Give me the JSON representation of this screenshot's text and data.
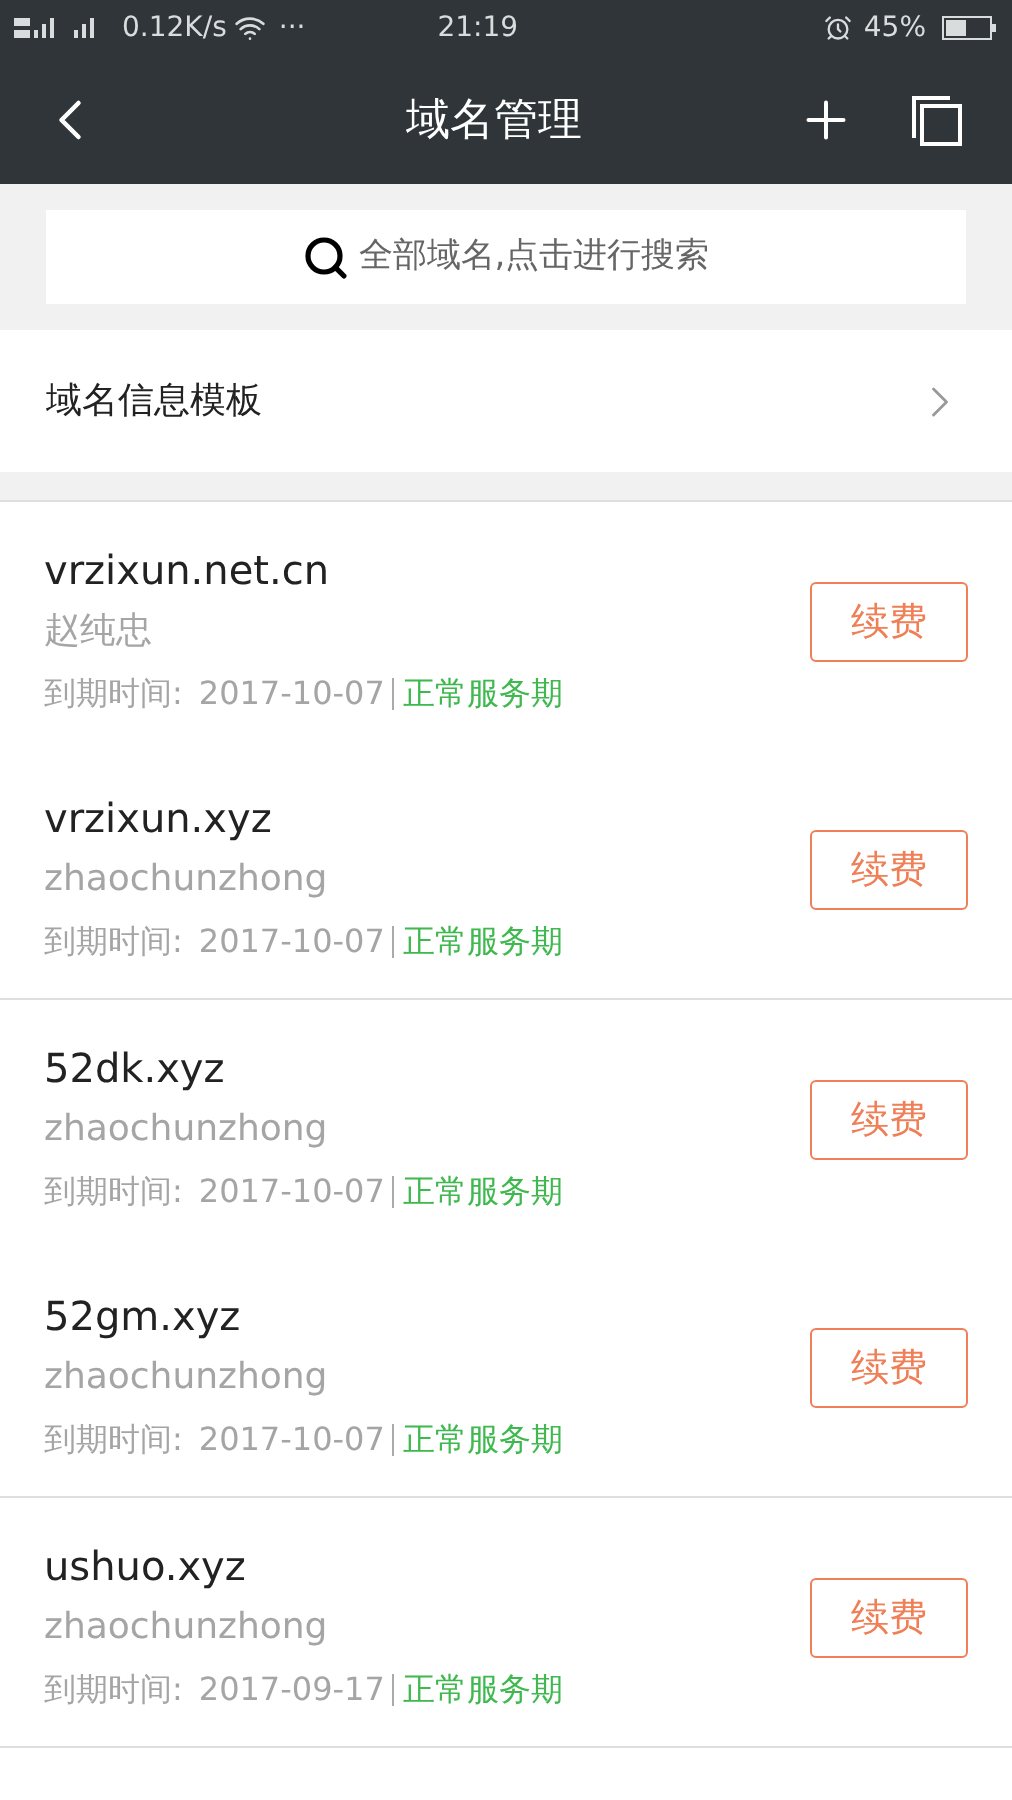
{
  "status_bar": {
    "network_speed": "0.12K/s",
    "more": "···",
    "time": "21:19",
    "battery": "45%"
  },
  "header": {
    "title": "域名管理"
  },
  "search": {
    "placeholder": "全部域名,点击进行搜索"
  },
  "template_row": {
    "label": "域名信息模板"
  },
  "groups": [
    {
      "items": [
        {
          "domain": "vrzixun.net.cn",
          "owner": "赵纯忠",
          "expiry_label": "到期时间:",
          "expiry_date": "2017-10-07",
          "status": "正常服务期",
          "button": "续费"
        },
        {
          "domain": "vrzixun.xyz",
          "owner": "zhaochunzhong",
          "expiry_label": "到期时间:",
          "expiry_date": "2017-10-07",
          "status": "正常服务期",
          "button": "续费"
        }
      ]
    },
    {
      "items": [
        {
          "domain": "52dk.xyz",
          "owner": "zhaochunzhong",
          "expiry_label": "到期时间:",
          "expiry_date": "2017-10-07",
          "status": "正常服务期",
          "button": "续费"
        },
        {
          "domain": "52gm.xyz",
          "owner": "zhaochunzhong",
          "expiry_label": "到期时间:",
          "expiry_date": "2017-10-07",
          "status": "正常服务期",
          "button": "续费"
        }
      ]
    },
    {
      "items": [
        {
          "domain": "ushuo.xyz",
          "owner": "zhaochunzhong",
          "expiry_label": "到期时间:",
          "expiry_date": "2017-09-17",
          "status": "正常服务期",
          "button": "续费"
        }
      ]
    }
  ]
}
